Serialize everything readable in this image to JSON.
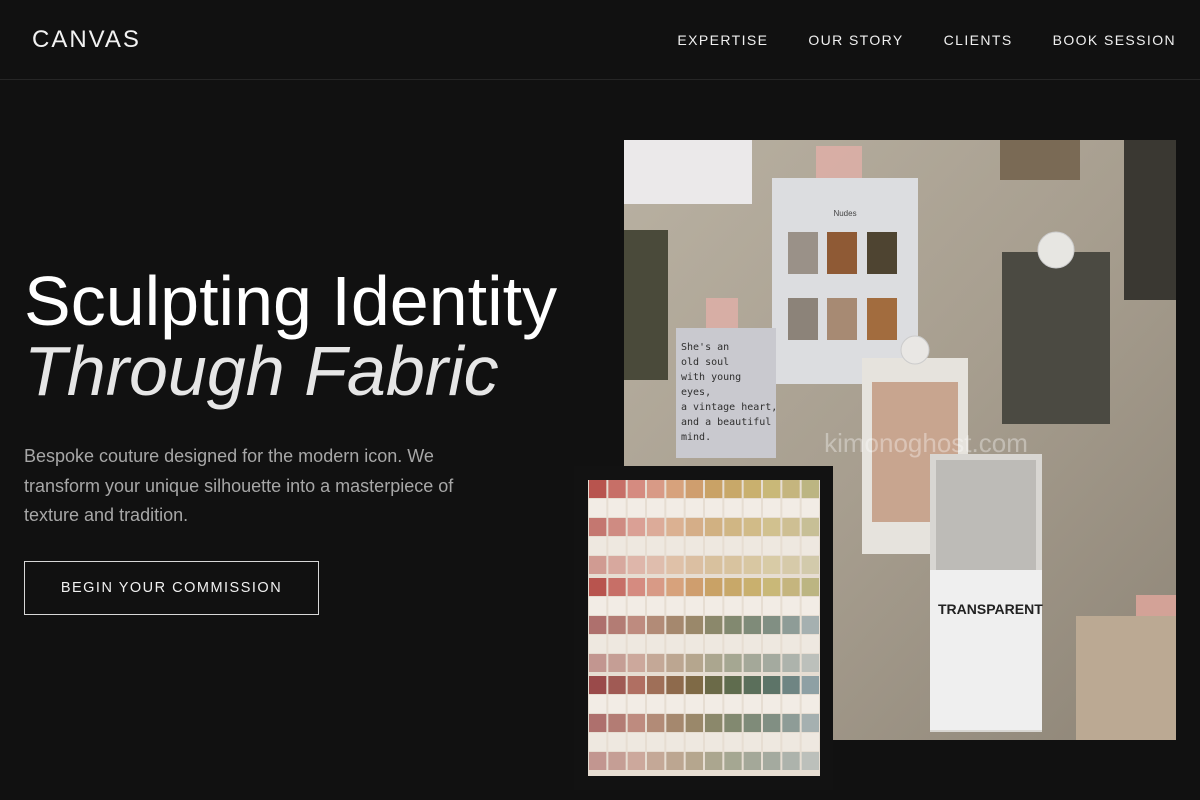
{
  "brand": {
    "logo": "CANVAS"
  },
  "nav": {
    "items": [
      {
        "label": "EXPERTISE"
      },
      {
        "label": "OUR STORY"
      },
      {
        "label": "CLIENTS"
      },
      {
        "label": "BOOK SESSION"
      }
    ]
  },
  "hero": {
    "title_line1": "Sculpting Identity",
    "title_line2": "Through Fabric",
    "description": "Bespoke couture designed for the modern icon. We transform your unique silhouette into a masterpiece of texture and tradition.",
    "cta_label": "BEGIN YOUR COMMISSION"
  },
  "moodboard": {
    "poem_card": [
      "She's an",
      "old soul",
      "with young",
      "eyes,",
      "a vintage heart,",
      "and a beautiful",
      "mind."
    ],
    "palette_card_title": "Nudes",
    "transparent_card_title": "TRANSPARENT",
    "watermark": "kimonoghost.com"
  },
  "colors": {
    "background": "#111111",
    "text_primary": "#ffffff",
    "text_muted": "#a7a7a7",
    "border": "#d8d8d8"
  }
}
